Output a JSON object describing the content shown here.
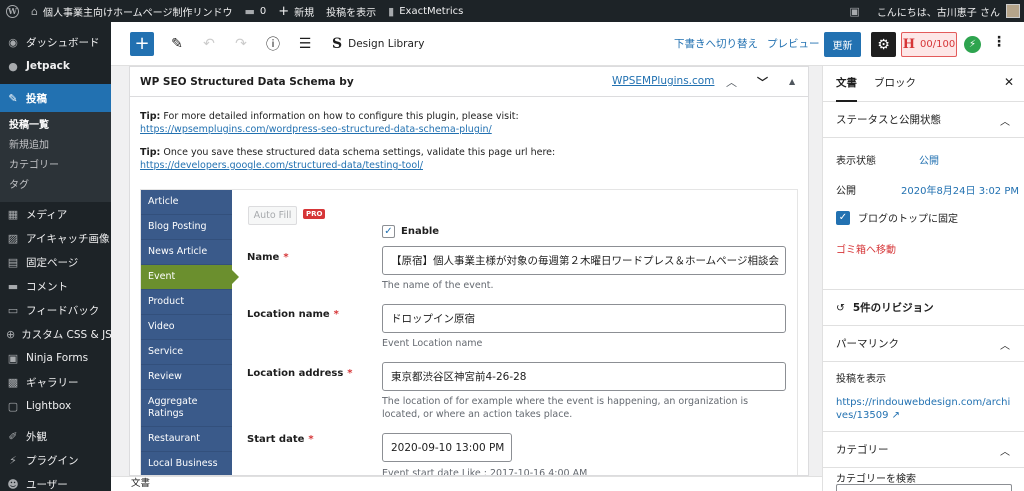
{
  "adminbar": {
    "site_name": "個人事業主向けホームページ制作リンドウ",
    "comments_count": "0",
    "new_label": "新規",
    "view_post": "投稿を表示",
    "exactmetrics": "ExactMetrics",
    "greeting": "こんにちは、古川恵子 さん"
  },
  "sidebar": {
    "dashboard": "ダッシュボード",
    "jetpack": "Jetpack",
    "posts": "投稿",
    "posts_sub": [
      "投稿一覧",
      "新規追加",
      "カテゴリー",
      "タグ"
    ],
    "media": "メディア",
    "eyecatch": "アイキャッチ画像",
    "pages": "固定ページ",
    "comments": "コメント",
    "feedback": "フィードバック",
    "custom_css": "カスタム CSS & JS",
    "ninja": "Ninja Forms",
    "gallery": "ギャラリー",
    "lightbox": "Lightbox",
    "appearance": "外観",
    "plugins": "プラグイン",
    "users": "ユーザー"
  },
  "toolbar": {
    "design_library": "Design Library",
    "save_draft": "下書きへ切り替え",
    "preview": "プレビュー",
    "update": "更新",
    "score": "00/100"
  },
  "panel": {
    "title": "WP SEO Structured Data Schema by",
    "link": "WPSEMPlugins.com",
    "tip1_label": "Tip:",
    "tip1_text": "For more detailed information on how to configure this plugin, please visit:",
    "tip1_url": "https://wpsemplugins.com/wordpress-seo-structured-data-schema-plugin/",
    "tip2_label": "Tip:",
    "tip2_text": "Once you save these structured data schema settings, validate this page url here:",
    "tip2_url": "https://developers.google.com/structured-data/testing-tool/"
  },
  "schema": {
    "tabs": [
      "Article",
      "Blog Posting",
      "News Article",
      "Event",
      "Product",
      "Video",
      "Service",
      "Review",
      "Aggregate Ratings",
      "Restaurant",
      "Local Business"
    ],
    "active_tab": "Event",
    "autofill": "Auto Fill",
    "pro": "PRO",
    "enable": "Enable",
    "fields": {
      "name_label": "Name",
      "name_value": "【原宿】個人事業主様が対象の毎週第２木曜日ワードプレス＆ホームページ相談会",
      "name_desc": "The name of the event.",
      "location_name_label": "Location name",
      "location_name_value": "ドロップイン原宿",
      "location_name_desc": "Event Location name",
      "location_address_label": "Location address",
      "location_address_value": "東京都渋谷区神宮前4-26-28",
      "location_address_desc": "The location of for example where the event is happening, an organization is located, or where an action takes place.",
      "start_date_label": "Start date",
      "start_date_value": "2020-09-10 13:00 PM",
      "start_date_desc": "Event start date Like : 2017-10-16 4:00 AM"
    }
  },
  "settings": {
    "tab_document": "文書",
    "tab_block": "ブロック",
    "status_title": "ステータスと公開状態",
    "visibility_label": "表示状態",
    "visibility_value": "公開",
    "publish_label": "公開",
    "publish_value": "2020年8月24日 3:02 PM",
    "sticky_label": "ブログのトップに固定",
    "trash": "ゴミ箱へ移動",
    "revisions": "5件のリビジョン",
    "permalink_title": "パーマリンク",
    "view_post": "投稿を表示",
    "permalink_url": "https://rindouwebdesign.com/archives/13509",
    "category_title": "カテゴリー",
    "category_search": "カテゴリーを検索"
  },
  "footer": {
    "breadcrumb": "文書"
  }
}
